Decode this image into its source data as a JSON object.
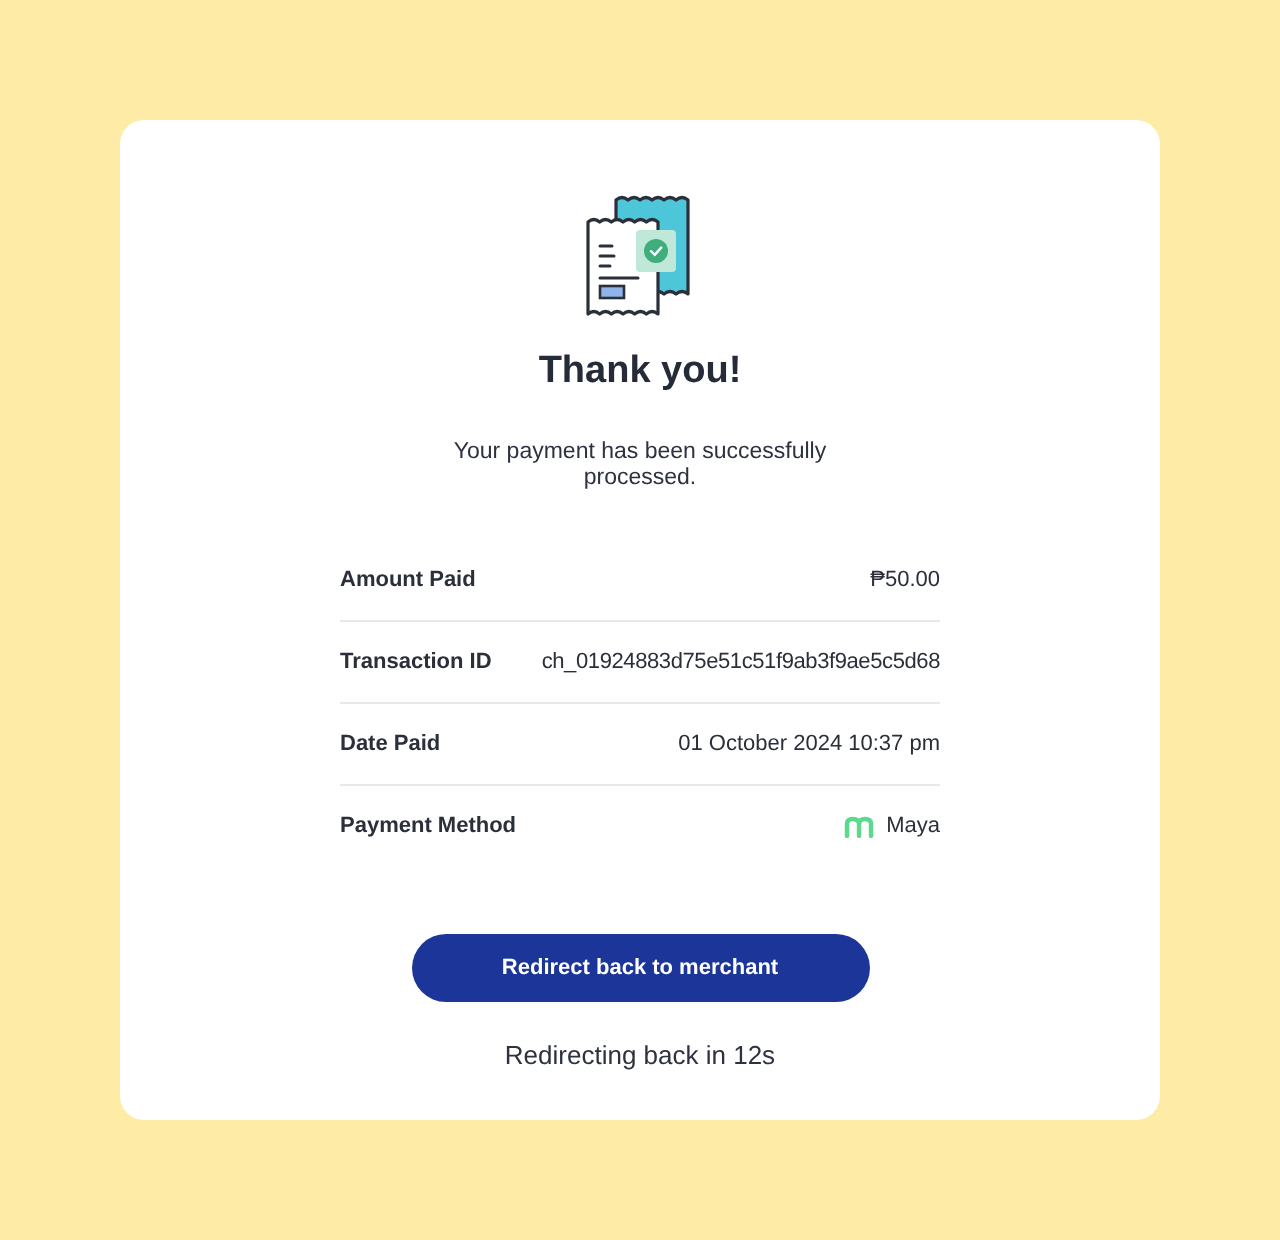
{
  "heading": "Thank you!",
  "message": "Your payment has been successfully processed.",
  "details": [
    {
      "kind": "text",
      "label": "Amount Paid",
      "value": "₱50.00"
    },
    {
      "kind": "text",
      "label": "Transaction ID",
      "value": "ch_01924883d75e51c51f9ab3f9ae5c5d68"
    },
    {
      "kind": "text",
      "label": "Date Paid",
      "value": "01 October 2024 10:37 pm"
    },
    {
      "kind": "wallet",
      "label": "Payment Method",
      "value": "Maya"
    }
  ],
  "button": {
    "label": "Redirect back to merchant"
  },
  "countdown": "Redirecting back in 12s"
}
